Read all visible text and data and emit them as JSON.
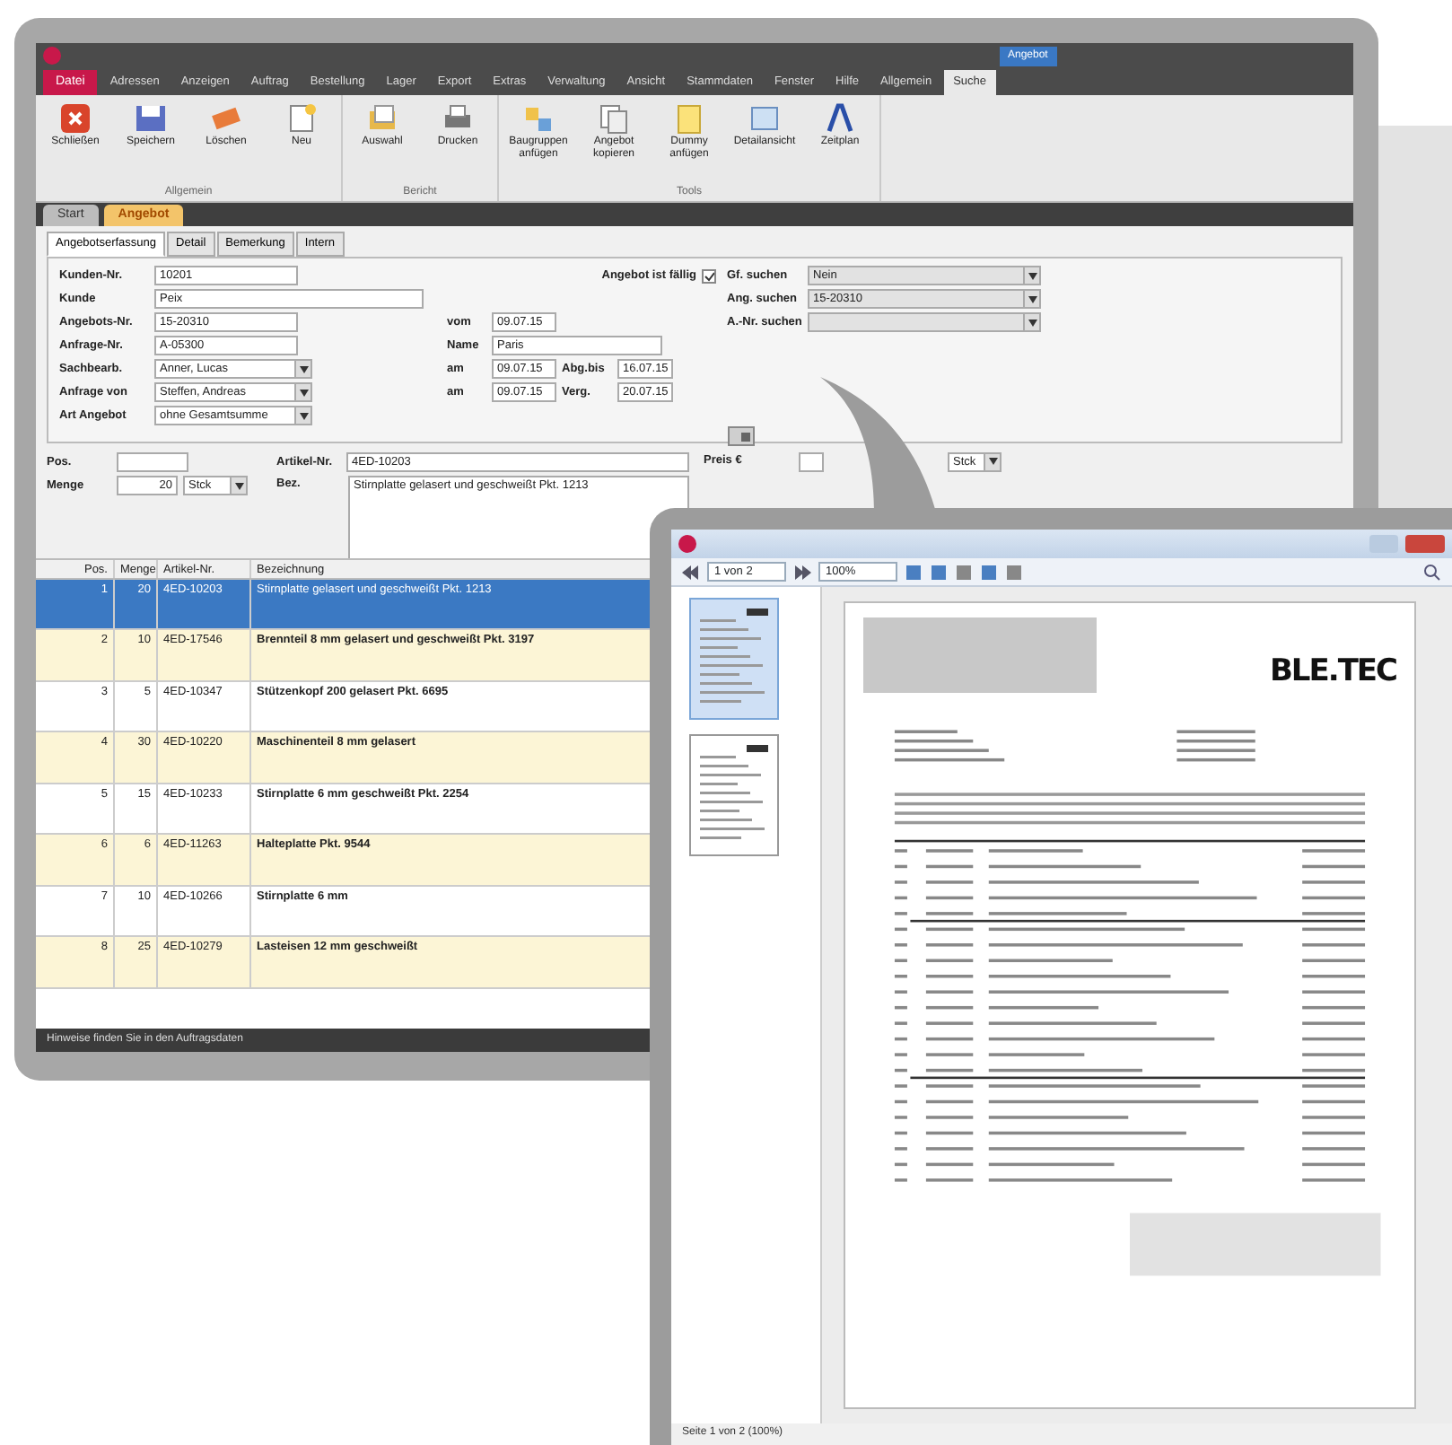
{
  "editor_window": {
    "file_tab": {
      "label": "Datei"
    },
    "context_header": "Angebot",
    "menu_tabs": [
      {
        "label": "Adressen",
        "selected": false
      },
      {
        "label": "Anzeigen",
        "selected": false
      },
      {
        "label": "Auftrag",
        "selected": false
      },
      {
        "label": "Bestellung",
        "selected": false
      },
      {
        "label": "Lager",
        "selected": false
      },
      {
        "label": "Export",
        "selected": false
      },
      {
        "label": "Extras",
        "selected": false
      },
      {
        "label": "Verwaltung",
        "selected": false
      },
      {
        "label": "Ansicht",
        "selected": false
      },
      {
        "label": "Stammdaten",
        "selected": false
      },
      {
        "label": "Fenster",
        "selected": false
      },
      {
        "label": "Hilfe",
        "selected": false
      },
      {
        "label": "Allgemein",
        "selected": false
      },
      {
        "label": "Suche",
        "selected": true
      }
    ],
    "ribbon_groups": [
      {
        "label": "Allgemein",
        "buttons": [
          {
            "label": "Schließen"
          },
          {
            "label": "Speichern"
          },
          {
            "label": "Löschen"
          },
          {
            "label": "Neu"
          }
        ]
      },
      {
        "label": "Bericht",
        "buttons": [
          {
            "label": "Auswahl"
          },
          {
            "label": "Drucken"
          }
        ]
      },
      {
        "label": "Tools",
        "buttons": [
          {
            "label": "Baugruppen anfügen"
          },
          {
            "label": "Angebot kopieren"
          },
          {
            "label": "Dummy anfügen"
          },
          {
            "label": "Detailansicht"
          },
          {
            "label": "Zeitplan"
          }
        ]
      }
    ],
    "document_tabs": [
      {
        "label": "Start",
        "selected": false
      },
      {
        "label": "Angebot",
        "selected": true
      }
    ],
    "form_tabs": [
      {
        "label": "Angebotserfassung",
        "selected": true
      },
      {
        "label": "Detail",
        "selected": false
      },
      {
        "label": "Bemerkung",
        "selected": false
      },
      {
        "label": "Intern",
        "selected": false
      }
    ],
    "left_fields": [
      {
        "label": "Kunden-Nr.",
        "value": "10201",
        "kind": "text"
      },
      {
        "label": "Kunde",
        "value": "Peix",
        "kind": "wide"
      },
      {
        "label": "Angebots-Nr.",
        "value": "15-20310",
        "kind": "text"
      },
      {
        "label": "Anfrage-Nr.",
        "value": "A-05300",
        "kind": "text"
      },
      {
        "label": "Sachbearb.",
        "value": "Anner, Lucas",
        "kind": "select"
      },
      {
        "label": "Anfrage von",
        "value": "Steffen, Andreas",
        "kind": "select"
      },
      {
        "label": "Art Angebot",
        "value": "ohne Gesamtsumme",
        "kind": "select"
      }
    ],
    "mid_fields": [
      {
        "label": "vom",
        "value": "09.07.15"
      },
      {
        "label": "Name",
        "value": "Paris"
      },
      {
        "label": "am",
        "value": "09.07.15"
      },
      {
        "label": "am",
        "value": "09.07.15"
      }
    ],
    "mid_extra": [
      {
        "label": "Abg.bis",
        "value": "16.07.15"
      },
      {
        "label": "Verg.",
        "value": "20.07.15"
      }
    ],
    "due_label": "Angebot ist fällig",
    "due_checked": true,
    "search_fields": [
      {
        "label": "Gf. suchen",
        "value": "Nein"
      },
      {
        "label": "Ang. suchen",
        "value": "15-20310"
      },
      {
        "label": "A.-Nr. suchen"
      }
    ],
    "position_fields": {
      "pos_label": "Pos.",
      "qty_label": "Menge",
      "qty_value": "20",
      "unit": "Stck",
      "article_label": "Artikel-Nr.",
      "article_value": "4ED-10203",
      "text_label": "Bez.",
      "text_value": "Stirnplatte gelasert und geschweißt Pkt. 1213",
      "price_label": "Preis €",
      "price_unit": "Stck"
    },
    "table": {
      "columns": [
        "Pos.",
        "Menge",
        "Artikel-Nr.",
        "Bezeichnung"
      ],
      "rows": [
        {
          "cells": [
            "1",
            "20",
            "4ED-10203",
            "Stirnplatte gelasert und geschweißt Pkt. 1213"
          ],
          "selected": true
        },
        {
          "cells": [
            "2",
            "10",
            "4ED-17546",
            "Brennteil 8 mm gelasert und geschweißt Pkt. 3197"
          ],
          "selected": false
        },
        {
          "cells": [
            "3",
            "5",
            "4ED-10347",
            "Stützenkopf 200 gelasert Pkt. 6695"
          ],
          "selected": false
        },
        {
          "cells": [
            "4",
            "30",
            "4ED-10220",
            "Maschinenteil 8 mm gelasert"
          ],
          "selected": false
        },
        {
          "cells": [
            "5",
            "15",
            "4ED-10233",
            "Stirnplatte 6 mm geschweißt Pkt. 2254"
          ],
          "selected": false
        },
        {
          "cells": [
            "6",
            "6",
            "4ED-11263",
            "Halteplatte Pkt. 9544"
          ],
          "selected": false
        },
        {
          "cells": [
            "7",
            "10",
            "4ED-10266",
            "Stirnplatte 6 mm"
          ],
          "selected": false
        },
        {
          "cells": [
            "8",
            "25",
            "4ED-10279",
            "Lasteisen 12 mm geschweißt"
          ],
          "selected": false
        }
      ]
    },
    "status_bar": "Hinweise finden Sie in den Auftragsdaten"
  },
  "viewer_window": {
    "toolbar": {
      "page_value": "1 von 2",
      "zoom_value": "100%"
    },
    "thumbnails": [
      {
        "selected": true
      },
      {
        "selected": false
      }
    ],
    "logo": "BLE.TEC",
    "status_bar": "Seite 1 von 2 (100%)"
  }
}
